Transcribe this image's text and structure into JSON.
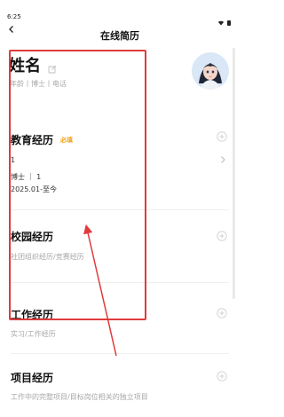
{
  "status_bar": {
    "time": "6:25"
  },
  "header": {
    "back_icon": "chevron-left-icon",
    "title": "在线简历"
  },
  "profile": {
    "name": "姓名",
    "meta": "年龄丨博士丨电话",
    "edit_icon": "edit-icon"
  },
  "sections": {
    "education": {
      "title": "教育经历",
      "required": "必填",
      "line1": "1",
      "line2": "博士 ｜ 1",
      "line3": "2025.01-至今"
    },
    "campus": {
      "title": "校园经历",
      "subtitle": "社团组织经历/竞赛经历"
    },
    "work": {
      "title": "工作经历",
      "subtitle": "实习/工作经历"
    },
    "project": {
      "title": "项目经历",
      "subtitle": "工作中的完整项目/目标岗位相关的独立项目"
    }
  },
  "colors": {
    "accent": "#f0a11a",
    "annotation": "#e03a3a"
  }
}
